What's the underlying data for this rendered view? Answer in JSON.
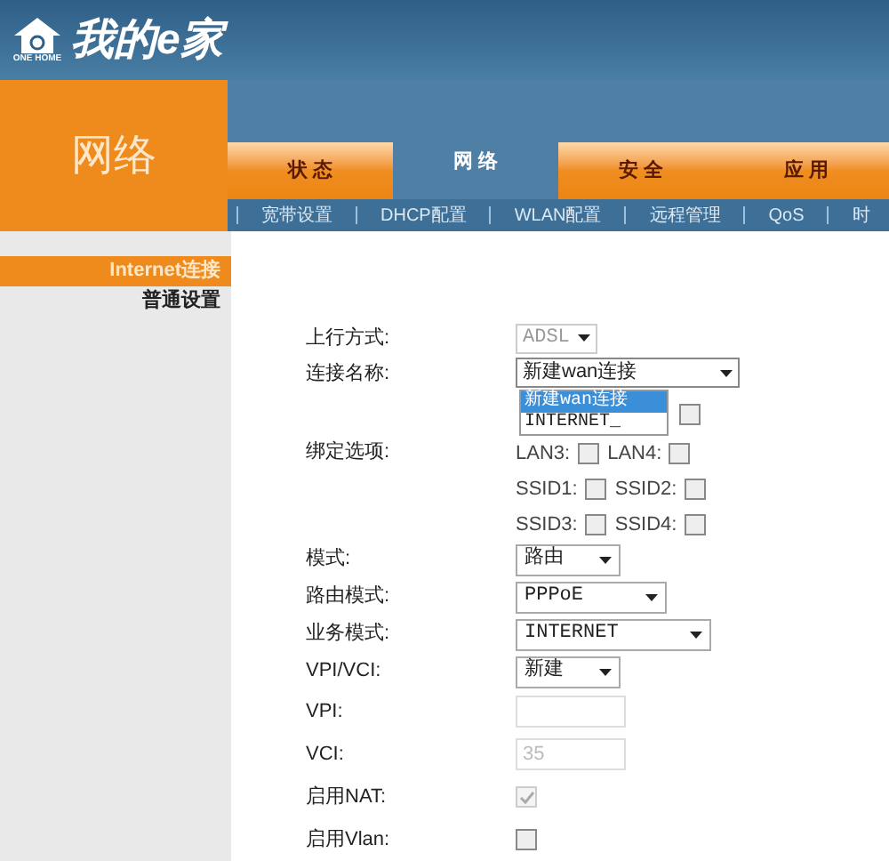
{
  "logo": {
    "badge": "ONE HOME",
    "title": "我的e家"
  },
  "section_title": "网络",
  "tabs": [
    {
      "label": "状 态",
      "selected": false
    },
    {
      "label": "网 络",
      "selected": true
    },
    {
      "label": "安 全",
      "selected": false
    },
    {
      "label": "应 用",
      "selected": false
    }
  ],
  "subnav": [
    "宽带设置",
    "DHCP配置",
    "WLAN配置",
    "远程管理",
    "QoS",
    "时"
  ],
  "sidebar": [
    {
      "label": "Internet连接",
      "selected": true
    },
    {
      "label": "普通设置",
      "selected": false
    }
  ],
  "form": {
    "uplink": {
      "label": "上行方式:",
      "value": "ADSL",
      "disabled": true
    },
    "connection": {
      "label": "连接名称:",
      "value": "新建wan连接",
      "options": [
        {
          "label": "新建wan连接",
          "selected": true
        },
        {
          "label": "INTERNET_",
          "selected": false
        }
      ]
    },
    "binding": {
      "label": "绑定选项:",
      "rows": [
        [
          {
            "checked": false
          }
        ],
        [
          {
            "label": "LAN3:",
            "checked": false
          },
          {
            "label": "LAN4:",
            "checked": false
          }
        ],
        [
          {
            "label": "SSID1:",
            "checked": false
          },
          {
            "label": "SSID2:",
            "checked": false
          }
        ],
        [
          {
            "label": "SSID3:",
            "checked": false
          },
          {
            "label": "SSID4:",
            "checked": false
          }
        ]
      ]
    },
    "fields": [
      {
        "kind": "select",
        "label": "模式:",
        "value": "路由"
      },
      {
        "kind": "select",
        "label": "路由模式:",
        "value": "PPPoE"
      },
      {
        "kind": "select",
        "label": "业务模式:",
        "value": "INTERNET"
      },
      {
        "kind": "select",
        "label": "VPI/VCI:",
        "value": "新建"
      },
      {
        "kind": "input",
        "label": "VPI:"
      },
      {
        "kind": "input",
        "label": "VCI:",
        "value": "35"
      },
      {
        "kind": "checkbox",
        "label": "启用NAT:",
        "checked": true,
        "disabled": true
      },
      {
        "kind": "checkbox",
        "label": "启用Vlan:",
        "checked": false
      }
    ]
  }
}
